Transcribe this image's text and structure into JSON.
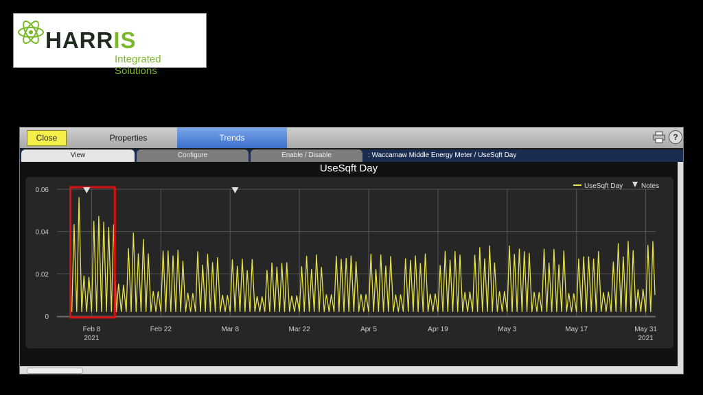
{
  "logo": {
    "name_dark": "HARR",
    "name_green": "IS",
    "subtitle": "Integrated Solutions"
  },
  "toolbar": {
    "close_label": "Close",
    "properties_label": "Properties",
    "trends_label": "Trends",
    "print_icon": "printer-icon",
    "help_label": "?"
  },
  "tabs": [
    {
      "label": "View",
      "active": true
    },
    {
      "label": "Configure",
      "active": false
    },
    {
      "label": "Enable / Disable",
      "active": false
    }
  ],
  "breadcrumb": ": Waccamaw Middle Energy Meter / UseSqft Day",
  "chart_data": {
    "type": "line",
    "title": "UseSqft Day",
    "y_ticks": [
      "0.06",
      "0.04",
      "0.02",
      "0"
    ],
    "ylim": [
      0,
      0.06
    ],
    "x_ticks": [
      {
        "label": "Feb 8",
        "sub": "2021"
      },
      {
        "label": "Feb 22",
        "sub": ""
      },
      {
        "label": "Mar 8",
        "sub": ""
      },
      {
        "label": "Mar 22",
        "sub": ""
      },
      {
        "label": "Apr 5",
        "sub": ""
      },
      {
        "label": "Apr 19",
        "sub": ""
      },
      {
        "label": "May 3",
        "sub": ""
      },
      {
        "label": "May 17",
        "sub": ""
      },
      {
        "label": "May 31",
        "sub": "2021"
      }
    ],
    "xlim": [
      "2021-02-01",
      "2021-06-02"
    ],
    "grid": true,
    "legend": {
      "position": "top-right",
      "series_label": "UseSqft Day",
      "notes_label": "Notes"
    },
    "line_color": "#e6e24a",
    "highlight_color": "#e01010",
    "highlight_range": [
      "2021-02-04",
      "2021-02-12"
    ],
    "note_markers": [
      "2021-02-07",
      "2021-03-09"
    ],
    "series": [
      {
        "name": "UseSqft Day",
        "x": [
          "2021-02-04",
          "2021-02-12",
          "2021-02-20",
          "2021-02-28",
          "2021-03-08",
          "2021-03-16",
          "2021-03-24",
          "2021-04-01",
          "2021-04-09",
          "2021-04-17",
          "2021-04-25",
          "2021-05-03",
          "2021-05-11",
          "2021-05-19",
          "2021-05-27",
          "2021-06-01"
        ],
        "peaks": [
          0.058,
          0.045,
          0.034,
          0.031,
          0.028,
          0.026,
          0.029,
          0.03,
          0.029,
          0.03,
          0.033,
          0.034,
          0.032,
          0.03,
          0.036,
          0.037
        ]
      }
    ]
  }
}
